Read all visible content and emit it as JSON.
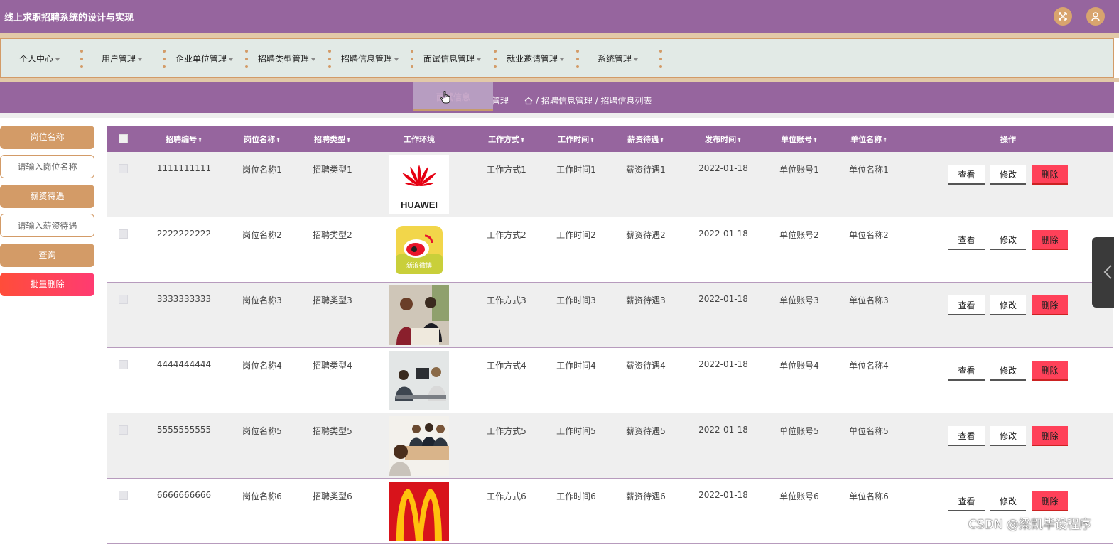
{
  "app": {
    "title": "线上求职招聘系统的设计与实现"
  },
  "nav": {
    "items": [
      "个人中心",
      "用户管理",
      "企业单位管理",
      "招聘类型管理",
      "招聘信息管理",
      "面试信息管理",
      "就业邀请管理",
      "系统管理"
    ]
  },
  "tab_popup": {
    "label": "面试信息"
  },
  "breadcrumb": {
    "left_fragment": "管理",
    "path": "/ 招聘信息管理 / 招聘信息列表"
  },
  "search": {
    "position_label": "岗位名称",
    "position_placeholder": "请输入岗位名称",
    "salary_label": "薪资待遇",
    "salary_placeholder": "请输入薪资待遇",
    "query_label": "查询",
    "batch_delete_label": "批量删除"
  },
  "table": {
    "headers": [
      "招聘编号",
      "岗位名称",
      "招聘类型",
      "工作环境",
      "工作方式",
      "工作时间",
      "薪资待遇",
      "发布时间",
      "单位账号",
      "单位名称",
      "操作"
    ],
    "view_label": "查看",
    "edit_label": "修改",
    "delete_label": "删除",
    "rows": [
      {
        "id": "1111111111",
        "position": "岗位名称1",
        "type": "招聘类型1",
        "image": "huawei-logo",
        "mode": "工作方式1",
        "time": "工作时间1",
        "salary": "薪资待遇1",
        "date": "2022-01-18",
        "account": "单位账号1",
        "company": "单位名称1"
      },
      {
        "id": "2222222222",
        "position": "岗位名称2",
        "type": "招聘类型2",
        "image": "weibo-logo",
        "mode": "工作方式2",
        "time": "工作时间2",
        "salary": "薪资待遇2",
        "date": "2022-01-18",
        "account": "单位账号2",
        "company": "单位名称2"
      },
      {
        "id": "3333333333",
        "position": "岗位名称3",
        "type": "招聘类型3",
        "image": "interview-photo",
        "mode": "工作方式3",
        "time": "工作时间3",
        "salary": "薪资待遇3",
        "date": "2022-01-18",
        "account": "单位账号3",
        "company": "单位名称3"
      },
      {
        "id": "4444444444",
        "position": "岗位名称4",
        "type": "招聘类型4",
        "image": "interview-photo",
        "mode": "工作方式4",
        "time": "工作时间4",
        "salary": "薪资待遇4",
        "date": "2022-01-18",
        "account": "单位账号4",
        "company": "单位名称4"
      },
      {
        "id": "5555555555",
        "position": "岗位名称5",
        "type": "招聘类型5",
        "image": "interview-photo",
        "mode": "工作方式5",
        "time": "工作时间5",
        "salary": "薪资待遇5",
        "date": "2022-01-18",
        "account": "单位账号5",
        "company": "单位名称5"
      },
      {
        "id": "6666666666",
        "position": "岗位名称6",
        "type": "招聘类型6",
        "image": "mcdonalds-logo",
        "mode": "工作方式6",
        "time": "工作时间6",
        "salary": "薪资待遇6",
        "date": "2022-01-18",
        "account": "单位账号6",
        "company": "单位名称6"
      }
    ]
  },
  "huawei_logo_text": "HUAWEI",
  "weibo_logo_text": "新浪微博",
  "watermark": "CSDN @梁凯毕设程序",
  "colors": {
    "header": "#96659e",
    "accent": "#d39b67",
    "nav_bg": "#e2eae6",
    "delete": "#ff4159"
  }
}
